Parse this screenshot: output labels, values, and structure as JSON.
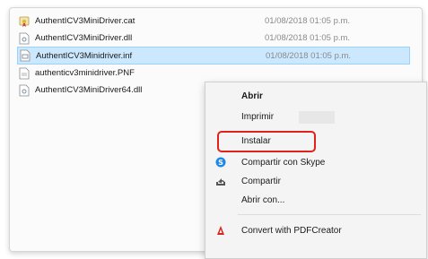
{
  "files": [
    {
      "name": "AuthentICV3MiniDriver.cat",
      "date": "01/08/2018 01:05 p.m.",
      "icon": "certificate-file-icon",
      "selected": false
    },
    {
      "name": "AuthentICV3MiniDriver.dll",
      "date": "01/08/2018 01:05 p.m.",
      "icon": "dll-file-icon",
      "selected": false
    },
    {
      "name": "AuthentICV3Minidriver.inf",
      "date": "01/08/2018 01:05 p.m.",
      "icon": "inf-file-icon",
      "selected": true
    },
    {
      "name": "authenticv3minidriver.PNF",
      "date": "",
      "icon": "pnf-file-icon",
      "selected": false
    },
    {
      "name": "AuthentICV3MiniDriver64.dll",
      "date": "",
      "icon": "dll-file-icon",
      "selected": false
    }
  ],
  "context_menu": {
    "items": [
      {
        "label": "Abrir",
        "bold": true,
        "icon": ""
      },
      {
        "label": "Imprimir",
        "bold": false,
        "icon": ""
      },
      {
        "label": "Instalar",
        "bold": false,
        "icon": ""
      },
      {
        "label": "Compartir con Skype",
        "bold": false,
        "icon": "skype-icon"
      },
      {
        "label": "Compartir",
        "bold": false,
        "icon": "share-icon"
      },
      {
        "label": "Abrir con...",
        "bold": false,
        "icon": ""
      },
      {
        "label": "Convert with PDFCreator",
        "bold": false,
        "icon": "pdfcreator-icon"
      }
    ]
  },
  "colors": {
    "selection": "#cce8ff",
    "highlight_border": "#e0211c",
    "skype": "#1e88e5",
    "pdfcreator": "#d9261c"
  }
}
